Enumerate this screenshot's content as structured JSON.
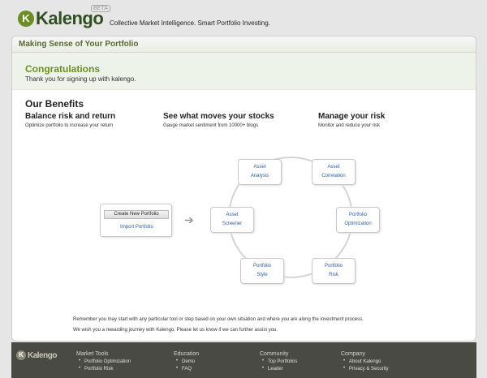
{
  "brand": {
    "logo_text": "Kalengo",
    "beta_label": "BETA",
    "tagline": "Collective Market Intelligence. Smart Portfolio Investing."
  },
  "panel": {
    "title": "Making Sense of Your Portfolio",
    "congrats": "Congratulations",
    "thanks": "Thank you for signing up with kalengo."
  },
  "benefits": {
    "title": "Our Benefits",
    "items": [
      {
        "title": "Balance risk and return",
        "desc": "Optimize portfolio to increase your return"
      },
      {
        "title": "See what moves your stocks",
        "desc": "Gauge market sentiment from 10000+ blogs"
      },
      {
        "title": "Manage your risk",
        "desc": "Monitor and reduce your risk"
      }
    ]
  },
  "start": {
    "create_label": "Create New Portfolio",
    "import_label": "Import Portfolio"
  },
  "cycle": {
    "nodes": [
      {
        "line1": "Asset",
        "line2": "Analysis"
      },
      {
        "line1": "Asset",
        "line2": "Correlation"
      },
      {
        "line1": "Asset",
        "line2": "Screener"
      },
      {
        "line1": "Portfolio",
        "line2": "Optimization"
      },
      {
        "line1": "Portfolio",
        "line2": "Style"
      },
      {
        "line1": "Portfolio",
        "line2": "Risk"
      }
    ]
  },
  "notes": {
    "line1": "Remember you may start with any particular tool or step based on your own situation and where you are along the investment process.",
    "line2": "We wish you a rewarding journey with Kalengo. Please let us know if we can further assist you."
  },
  "footer": {
    "logo_text": "Kalengo",
    "columns": [
      {
        "heading": "Market Tools",
        "items": [
          "Portfolio Optimization",
          "Portfolio Risk"
        ]
      },
      {
        "heading": "Education",
        "items": [
          "Demo",
          "FAQ"
        ]
      },
      {
        "heading": "Community",
        "items": [
          "Top Portfolios",
          "Leader"
        ]
      },
      {
        "heading": "Company",
        "items": [
          "About Kalengo",
          "Privacy & Security"
        ]
      }
    ]
  },
  "colors": {
    "brand_green": "#6b8e23",
    "link_blue": "#2a5db0",
    "footer_bg": "#4a4a45"
  }
}
